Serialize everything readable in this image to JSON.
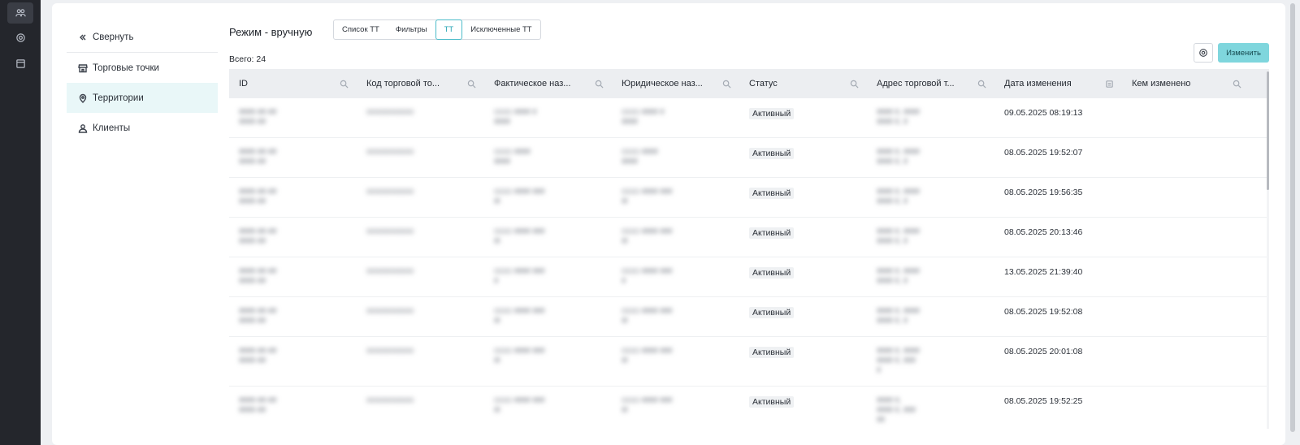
{
  "nav": {
    "collapse_label": "Свернуть",
    "items": [
      {
        "label": "Торговые точки"
      },
      {
        "label": "Территории"
      },
      {
        "label": "Клиенты"
      }
    ]
  },
  "header": {
    "mode_title": "Режим - вручную",
    "tabs": [
      "Список ТТ",
      "Фильтры",
      "ТТ",
      "Исключенные ТТ"
    ],
    "active_tab": "ТТ",
    "total": "Всего: 24",
    "edit_label": "Изменить"
  },
  "table": {
    "columns": [
      "ID",
      "Код торговой то...",
      "Фактическое наз...",
      "Юридическое наз...",
      "Статус",
      "Адрес торговой т...",
      "Дата изменения",
      "Кем изменено"
    ],
    "rows": [
      {
        "status": "Активный",
        "date": "09.05.2025 08:19:13"
      },
      {
        "status": "Активный",
        "date": "08.05.2025 19:52:07"
      },
      {
        "status": "Активный",
        "date": "08.05.2025 19:56:35"
      },
      {
        "status": "Активный",
        "date": "08.05.2025 20:13:46"
      },
      {
        "status": "Активный",
        "date": "13.05.2025 21:39:40"
      },
      {
        "status": "Активный",
        "date": "08.05.2025 19:52:08"
      },
      {
        "status": "Активный",
        "date": "08.05.2025 20:01:08"
      },
      {
        "status": "Активный",
        "date": "08.05.2025 19:52:25"
      }
    ]
  },
  "colors": {
    "accent": "#4cbcc9",
    "edit_button": "#7fd6dd",
    "sidebar": "#24262c"
  }
}
